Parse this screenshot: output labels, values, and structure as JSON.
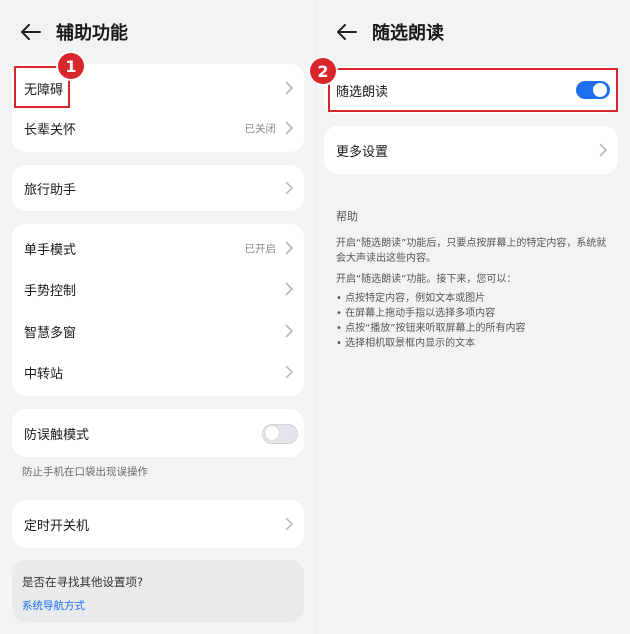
{
  "left_panel": {
    "title": "辅助功能",
    "group1": [
      {
        "label": "无障碍",
        "value": ""
      },
      {
        "label": "长辈关怀",
        "value": "已关闭"
      }
    ],
    "group2": [
      {
        "label": "旅行助手",
        "value": ""
      }
    ],
    "group3": [
      {
        "label": "单手模式",
        "value": "已开启"
      },
      {
        "label": "手势控制",
        "value": ""
      },
      {
        "label": "智慧多窗",
        "value": ""
      },
      {
        "label": "中转站",
        "value": ""
      }
    ],
    "mistouch": {
      "label": "防误触模式",
      "enabled": false,
      "note": "防止手机在口袋出现误操作"
    },
    "timer": {
      "label": "定时开关机"
    },
    "search": {
      "question": "是否在寻找其他设置项?",
      "link": "系统导航方式"
    }
  },
  "right_panel": {
    "title": "随选朗读",
    "toggle_row": {
      "label": "随选朗读",
      "enabled": true
    },
    "more": {
      "label": "更多设置"
    },
    "help": {
      "title": "帮助",
      "p1": "开启“随选朗读”功能后，只要点按屏幕上的特定内容，系统就会大声读出这些内容。",
      "p2": "开启“随选朗读”功能。接下来，您可以：",
      "items": [
        "点按特定内容，例如文本或图片",
        "在屏幕上拖动手指以选择多项内容",
        "点按“播放”按钮来听取屏幕上的所有内容",
        "选择相机取景框内显示的文本"
      ]
    }
  },
  "annotations": {
    "badge1": "1",
    "badge2": "2"
  },
  "colors": {
    "accent": "#1e6ef0",
    "annotation_red": "#d9262c"
  }
}
